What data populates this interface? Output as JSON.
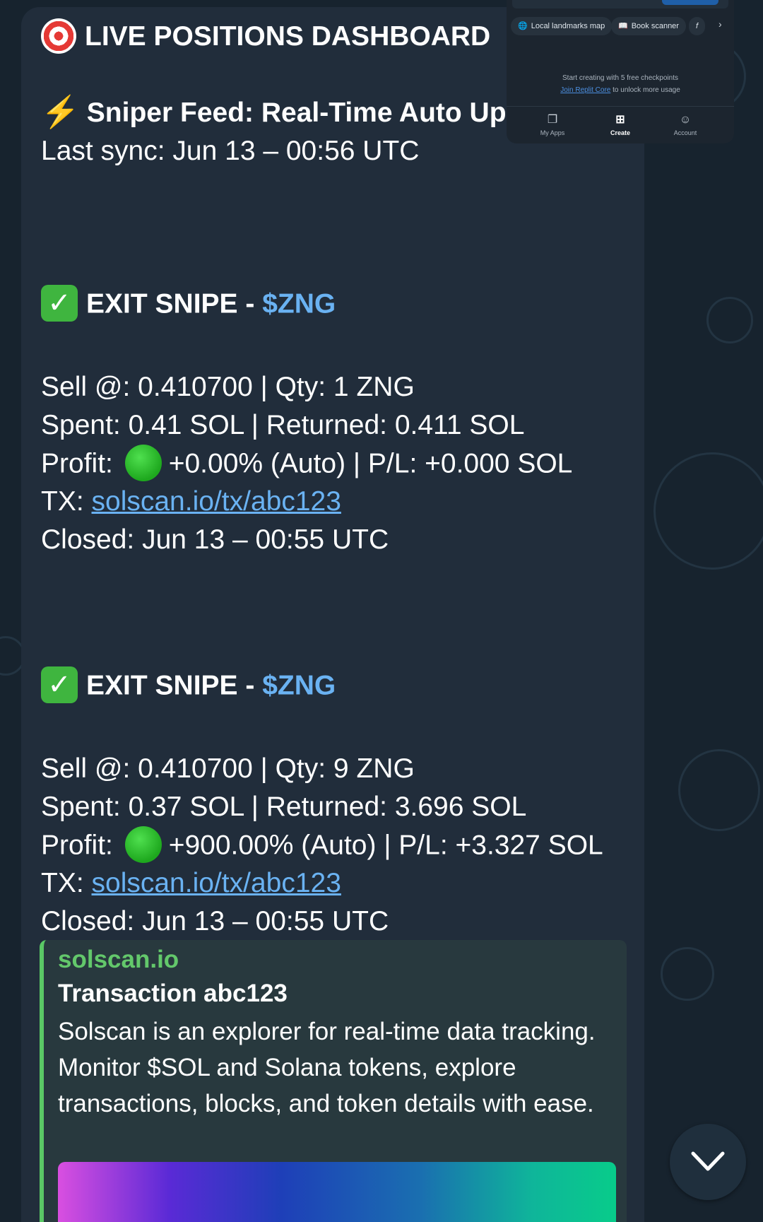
{
  "message": {
    "header": {
      "title": "LIVE POSITIONS DASHBOARD",
      "feed_title": "Sniper Feed: Real-Time Auto Upc",
      "last_sync": "Last sync: Jun 13 – 00:56 UTC"
    },
    "exits": [
      {
        "heading": "EXIT SNIPE - ",
        "ticker": "$ZNG",
        "sell": "Sell @: 0.410700 | Qty: 1 ZNG",
        "spent": "Spent: 0.41 SOL | Returned: 0.411 SOL",
        "profit_label": "Profit: ",
        "profit_value": "+0.00% (Auto) | P/L: +0.000 SOL",
        "tx_label": "TX: ",
        "tx_link": "solscan.io/tx/abc123",
        "closed": "Closed: Jun 13 – 00:55 UTC"
      },
      {
        "heading": "EXIT SNIPE - ",
        "ticker": "$ZNG",
        "sell": "Sell @: 0.410700 | Qty: 9 ZNG",
        "spent": "Spent: 0.37 SOL | Returned: 3.696 SOL",
        "profit_label": "Profit: ",
        "profit_value": "+900.00% (Auto) | P/L: +3.327 SOL",
        "tx_label": "TX: ",
        "tx_link": "solscan.io/tx/abc123",
        "closed": "Closed: Jun 13 – 00:55 UTC"
      }
    ],
    "link_preview": {
      "site": "solscan.io",
      "title": "Transaction abc123",
      "description": "Solscan is an explorer for real-time data tracking. Monitor $SOL and Solana tokens, explore transactions, blocks, and token details with ease."
    }
  },
  "overlay": {
    "chips": [
      {
        "icon": "globe-icon",
        "label": "Local landmarks map"
      },
      {
        "icon": "book-icon",
        "label": "Book scanner"
      },
      {
        "icon": "function-icon",
        "label": "f"
      }
    ],
    "info_line": "Start creating with 5 free checkpoints",
    "info_link": "Join Replit Core",
    "info_suffix": " to unlock more usage",
    "nav": [
      {
        "icon": "apps-icon",
        "label": "My Apps"
      },
      {
        "icon": "plus-square-icon",
        "label": "Create",
        "active": true
      },
      {
        "icon": "user-icon",
        "label": "Account"
      }
    ]
  },
  "colors": {
    "bubble_bg": "#212d3b",
    "link": "#6ab2f2",
    "preview_accent": "#5ac865",
    "chat_bg": "#17232e"
  },
  "icons": {
    "header": "target-icon",
    "feed": "lightning-icon",
    "exit": "check-mark-icon",
    "profit": "green-circle-icon",
    "scroll": "chevron-down-icon"
  }
}
